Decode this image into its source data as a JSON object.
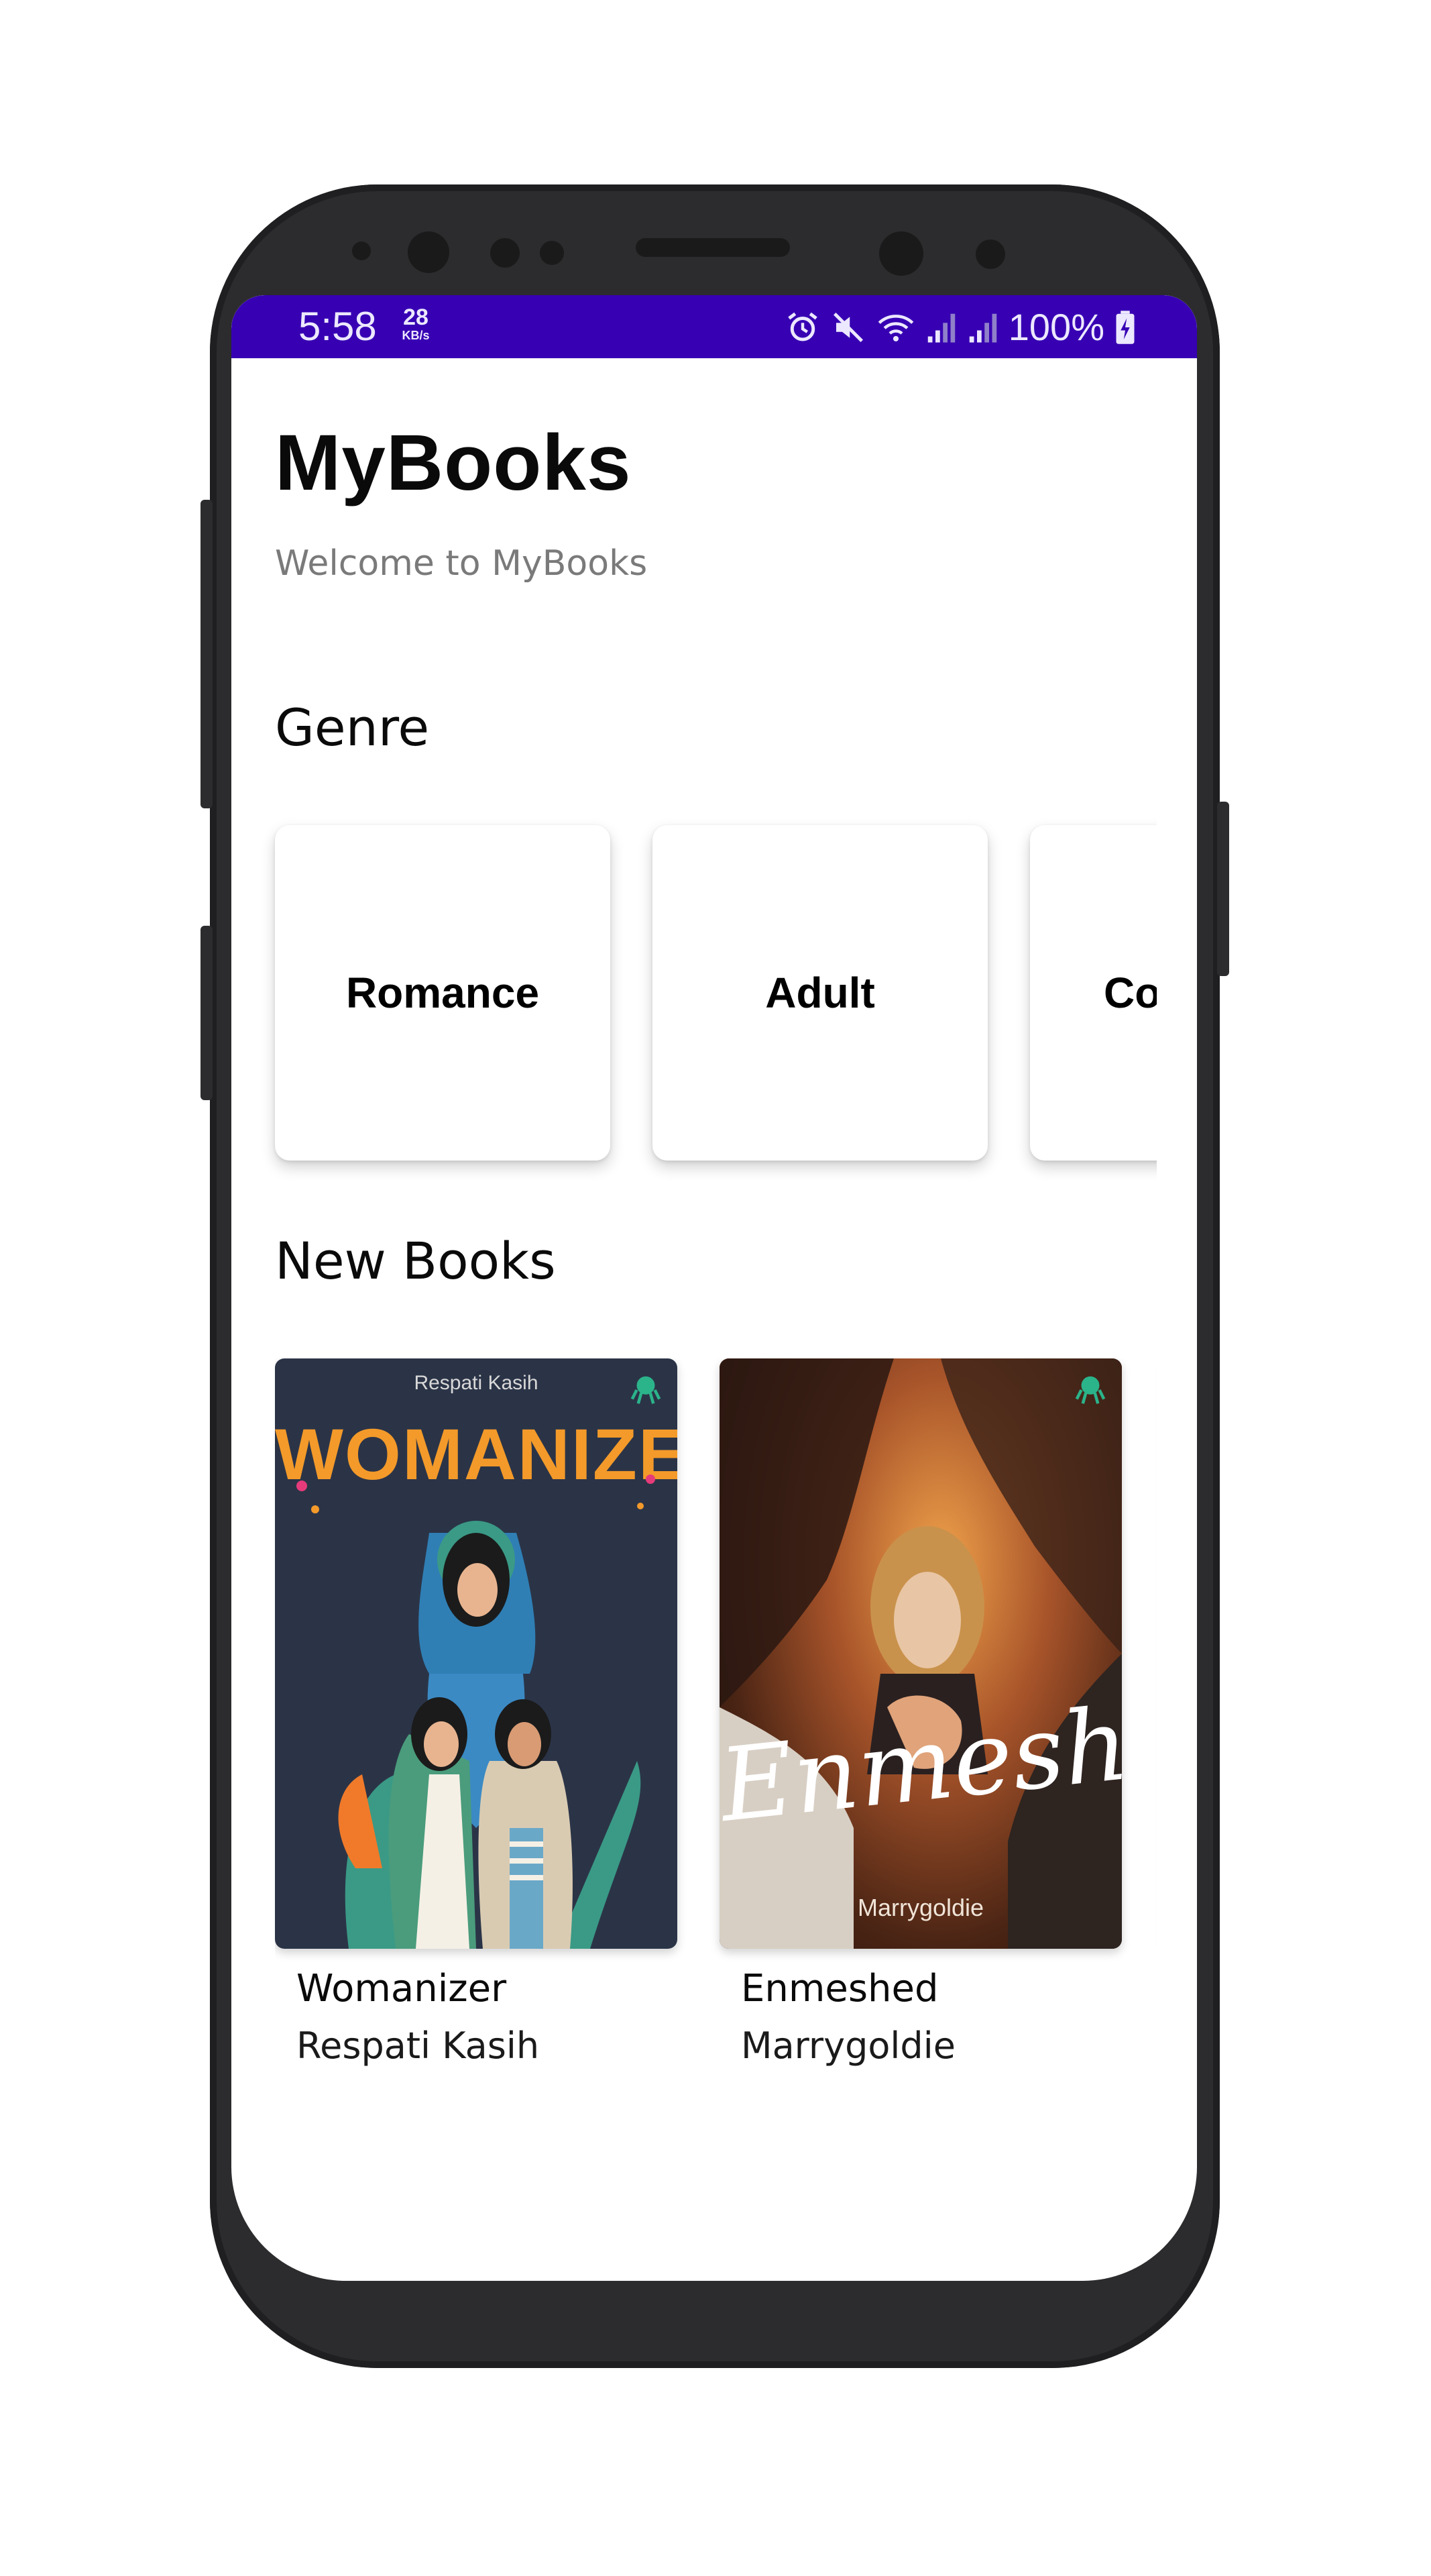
{
  "status_bar": {
    "time": "5:58",
    "net_speed_value": "28",
    "net_speed_unit": "KB/s",
    "battery_percent": "100%",
    "icons": [
      "alarm-icon",
      "mute-icon",
      "wifi-icon",
      "signal-icon",
      "signal-icon",
      "battery-charging-icon"
    ],
    "color": "#3700b3"
  },
  "header": {
    "title": "MyBooks",
    "subtitle": "Welcome to MyBooks"
  },
  "genre_section": {
    "title": "Genre",
    "items": [
      {
        "label": "Romance"
      },
      {
        "label": "Adult"
      },
      {
        "label": "Cor"
      }
    ]
  },
  "new_books_section": {
    "title": "New Books",
    "books": [
      {
        "title": "Womanizer",
        "author": "Respati Kasih",
        "cover_author": "Respati Kasih",
        "cover_title": "WOMANIZER"
      },
      {
        "title": "Enmeshed",
        "author": "Marrygoldie",
        "cover_author": "Marrygoldie",
        "cover_title": "Enmeshed"
      }
    ]
  }
}
